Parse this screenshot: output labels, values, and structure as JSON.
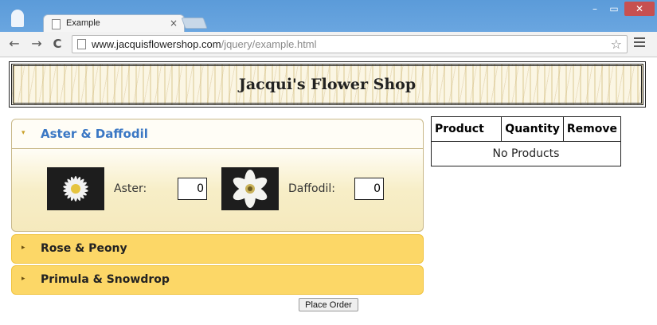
{
  "browser": {
    "tab_title": "Example",
    "tab_close": "×",
    "url_host": "www.jacquisflowershop.com",
    "url_path": "/jquery/example.html",
    "back_glyph": "←",
    "forward_glyph": "→",
    "reload_glyph": "C",
    "star_glyph": "☆",
    "min_glyph": "–",
    "max_glyph": "▭",
    "close_glyph": "✕"
  },
  "page": {
    "title": "Jacqui's Flower Shop",
    "accordion": {
      "active_section": {
        "label": "Aster & Daffodil",
        "arrow": "▾",
        "products": [
          {
            "label": "Aster:",
            "quantity": "0",
            "image": "aster-flower"
          },
          {
            "label": "Daffodil:",
            "quantity": "0",
            "image": "daffodil-flower"
          }
        ]
      },
      "collapsed_sections": [
        {
          "label": "Rose & Peony",
          "arrow": "▸"
        },
        {
          "label": "Primula & Snowdrop",
          "arrow": "▸"
        }
      ]
    },
    "place_order_label": "Place Order",
    "basket": {
      "columns": [
        "Product",
        "Quantity",
        "Remove"
      ],
      "empty_text": "No Products"
    }
  },
  "colors": {
    "accent_link": "#3a77c4",
    "collapsed_header": "#fcd767",
    "title_bar": "#5b9bd9"
  }
}
